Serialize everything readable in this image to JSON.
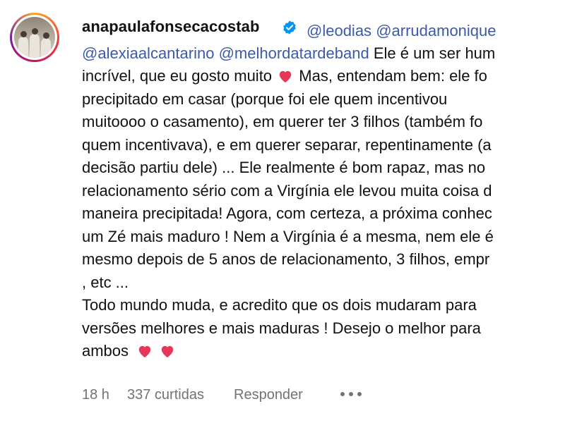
{
  "comment": {
    "username": "anapaulafonsecacostab",
    "mentions": [
      "@leodias",
      "@arrudamonique",
      "@alexiaalcantarino",
      "@melhordatardeband"
    ],
    "lines": [
      "Ele é um ser hum",
      "incrível, que eu gosto muito",
      "Mas, entendam bem: ele fo",
      "precipitado em casar (porque foi ele quem incentivou",
      "muitoooo o casamento), em querer ter 3 filhos (também fo",
      "quem incentivava), e em querer separar, repentinamente (a",
      "decisão partiu dele) ... Ele realmente é bom rapaz, mas no",
      "relacionamento sério com a Virgínia ele levou muita coisa d",
      "maneira precipitada! Agora, com certeza, a próxima conhec",
      "um Zé mais maduro ! Nem a Virgínia é a mesma, nem ele é",
      "mesmo depois de 5 anos de relacionamento, 3 filhos, empr",
      ", etc ...",
      "Todo mundo muda, e acredito que os dois mudaram para",
      "versões melhores e mais maduras ! Desejo o melhor para",
      "ambos"
    ],
    "heart_color": "#e8355a",
    "mention_color": "#3b5aa8"
  },
  "meta": {
    "time": "18 h",
    "likes": "337 curtidas",
    "reply": "Responder"
  },
  "icons": {
    "verified": "verified-badge-icon",
    "more": "more-options-icon",
    "heart": "red-heart-emoji"
  }
}
